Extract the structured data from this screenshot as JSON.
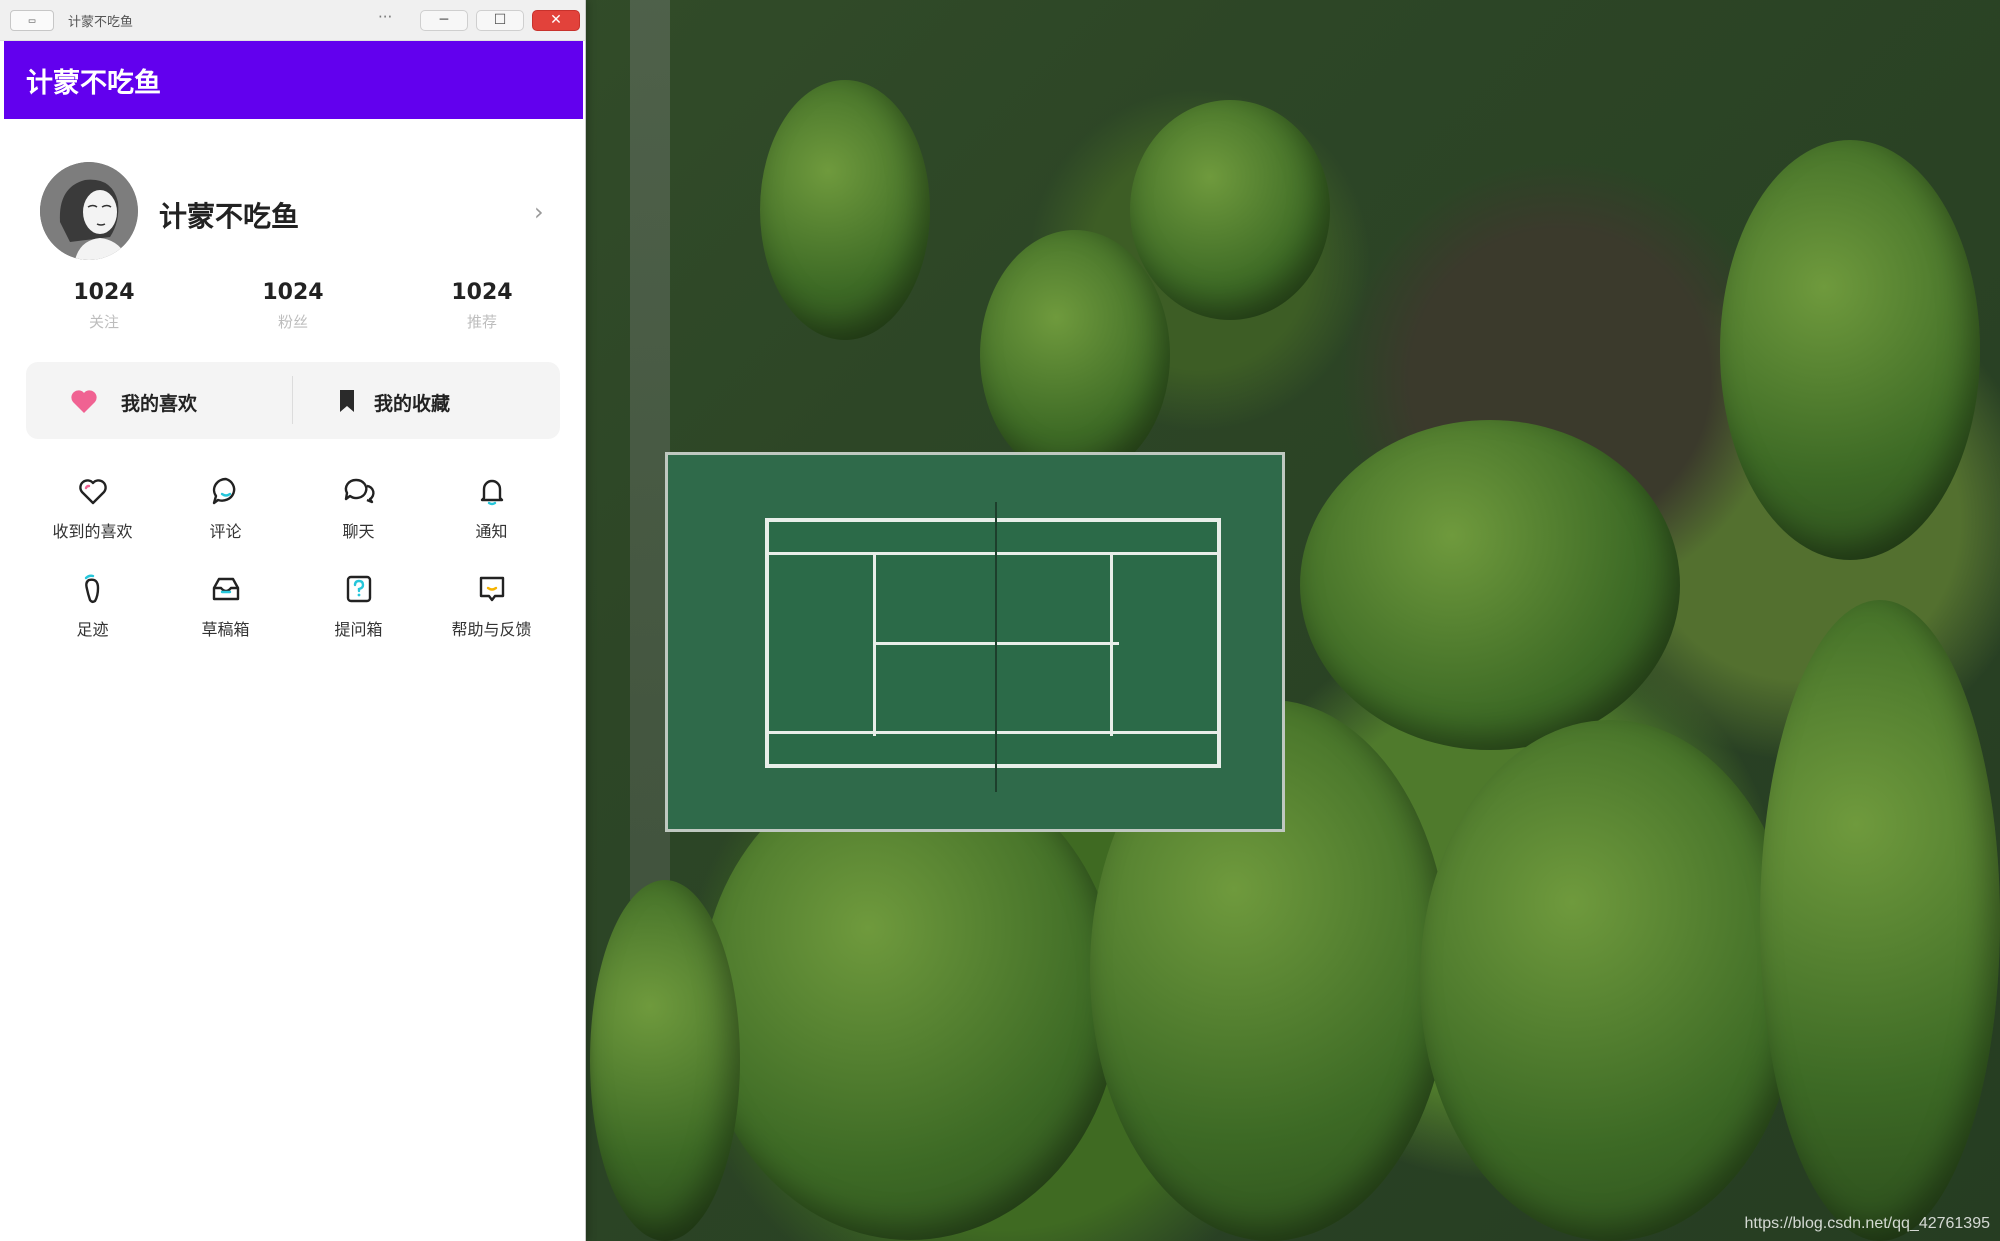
{
  "window": {
    "app_icon_text": "▭",
    "title": "计蒙不吃鱼",
    "more": "···",
    "minimize": "─",
    "maximize": "☐",
    "close": "✕"
  },
  "appbar": {
    "title": "计蒙不吃鱼"
  },
  "profile": {
    "username": "计蒙不吃鱼",
    "chevron": "›"
  },
  "stats": [
    {
      "value": "1024",
      "label": "关注"
    },
    {
      "value": "1024",
      "label": "粉丝"
    },
    {
      "value": "1024",
      "label": "推荐"
    }
  ],
  "favorites": {
    "likes_label": "我的喜欢",
    "collect_label": "我的收藏",
    "likes_icon": "heart-icon",
    "collect_icon": "bookmark-icon",
    "heart_color": "#f06292"
  },
  "menu": [
    {
      "label": "收到的喜欢",
      "icon": "heart-outline-icon"
    },
    {
      "label": "评论",
      "icon": "comment-icon"
    },
    {
      "label": "聊天",
      "icon": "chat-icon"
    },
    {
      "label": "通知",
      "icon": "bell-icon"
    },
    {
      "label": "足迹",
      "icon": "footprint-icon"
    },
    {
      "label": "草稿箱",
      "icon": "inbox-icon"
    },
    {
      "label": "提问箱",
      "icon": "question-box-icon"
    },
    {
      "label": "帮助与反馈",
      "icon": "feedback-icon"
    }
  ],
  "accent_color": "#6200ee",
  "icon_accent_color": "#26c6da",
  "desktop": {
    "watermark": "https://blog.csdn.net/qq_42761395"
  }
}
